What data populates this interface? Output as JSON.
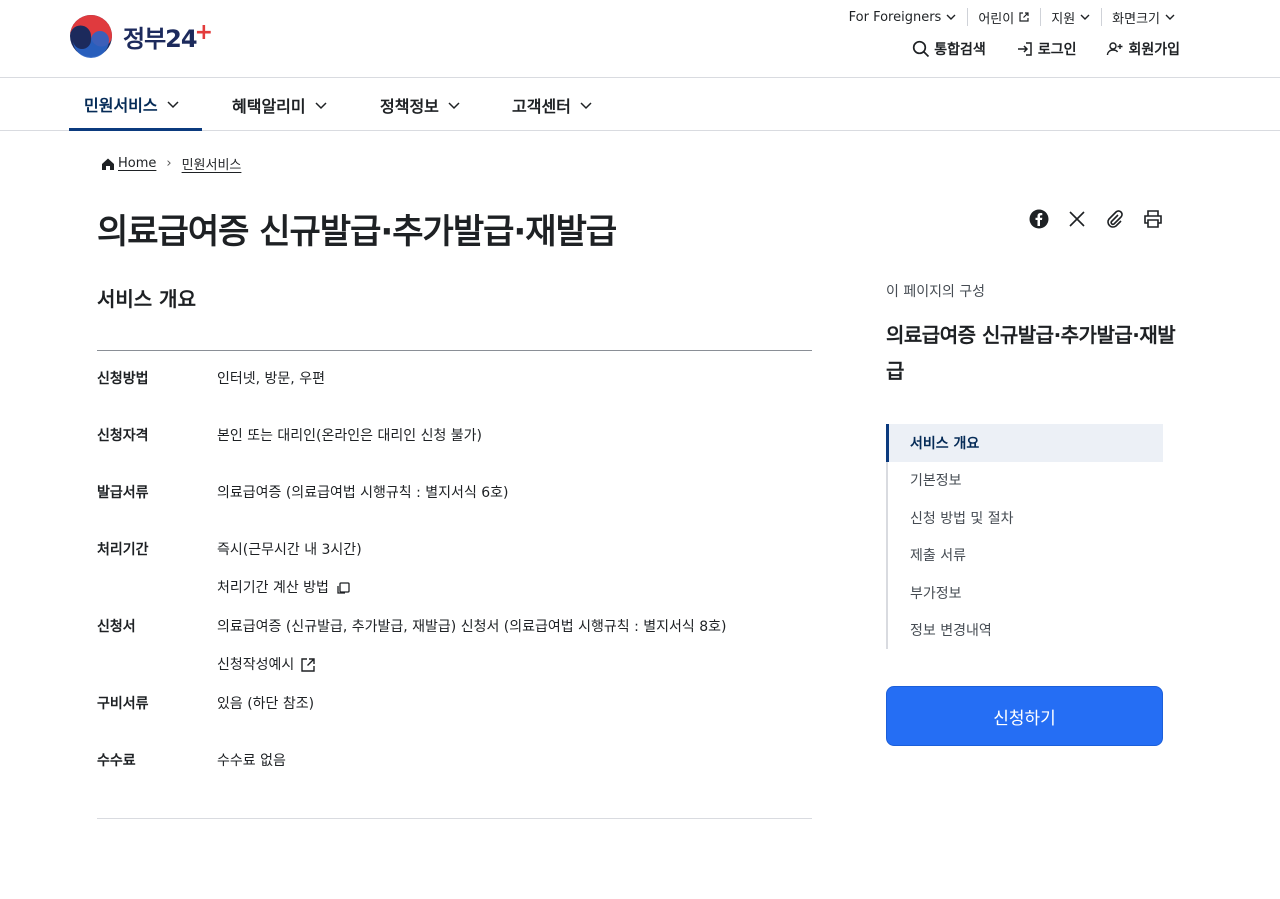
{
  "header": {
    "logo_text": "정부24",
    "logo_plus": "+",
    "util": [
      {
        "label": "For Foreigners",
        "icon": "chevron-down-icon"
      },
      {
        "label": "어린이",
        "icon": "external-link-icon"
      },
      {
        "label": "지원",
        "icon": "chevron-down-icon"
      },
      {
        "label": "화면크기",
        "icon": "chevron-down-icon"
      }
    ],
    "quick": [
      {
        "label": "통합검색",
        "icon": "search-icon"
      },
      {
        "label": "로그인",
        "icon": "login-icon"
      },
      {
        "label": "회원가입",
        "icon": "user-plus-icon"
      }
    ]
  },
  "gnb": {
    "items": [
      {
        "label": "민원서비스",
        "active": true
      },
      {
        "label": "혜택알리미",
        "active": false
      },
      {
        "label": "정책정보",
        "active": false
      },
      {
        "label": "고객센터",
        "active": false
      }
    ]
  },
  "breadcrumb": {
    "home": "Home",
    "current": "민원서비스"
  },
  "page": {
    "title": "의료급여증 신규발급·추가발급·재발급",
    "share_icons": [
      "facebook-icon",
      "x-icon",
      "link-icon",
      "print-icon"
    ]
  },
  "overview": {
    "heading": "서비스 개요",
    "rows": [
      {
        "label": "신청방법",
        "values": [
          "인터넷, 방문, 우편"
        ]
      },
      {
        "label": "신청자격",
        "values": [
          "본인 또는 대리인(온라인은 대리인 신청 불가)"
        ]
      },
      {
        "label": "발급서류",
        "values": [
          "의료급여증 (의료급여법 시행규칙 : 별지서식 6호)"
        ]
      },
      {
        "label": "처리기간",
        "values": [
          "즉시(근무시간 내 3시간)",
          "처리기간 계산 방법"
        ]
      },
      {
        "label": "신청서",
        "values": [
          "의료급여증 (신규발급, 추가발급, 재발급) 신청서 (의료급여법 시행규칙 : 별지서식 8호)",
          "신청작성예시"
        ]
      },
      {
        "label": "구비서류",
        "values": [
          "있음 (하단 참조)"
        ]
      },
      {
        "label": "수수료",
        "values": [
          "수수료 없음"
        ]
      }
    ]
  },
  "toc": {
    "caption": "이 페이지의 구성",
    "title": "의료급여증 신규발급·추가발급·재발급",
    "items": [
      {
        "label": "서비스 개요",
        "active": true
      },
      {
        "label": "기본정보",
        "active": false
      },
      {
        "label": "신청 방법 및 절차",
        "active": false
      },
      {
        "label": "제출 서류",
        "active": false
      },
      {
        "label": "부가정보",
        "active": false
      },
      {
        "label": "정보 변경내역",
        "active": false
      }
    ],
    "apply_label": "신청하기"
  },
  "colors": {
    "primary": "#256ef4",
    "nav_active": "#0b3a7e",
    "toc_active_bg": "#ecf0f6"
  }
}
